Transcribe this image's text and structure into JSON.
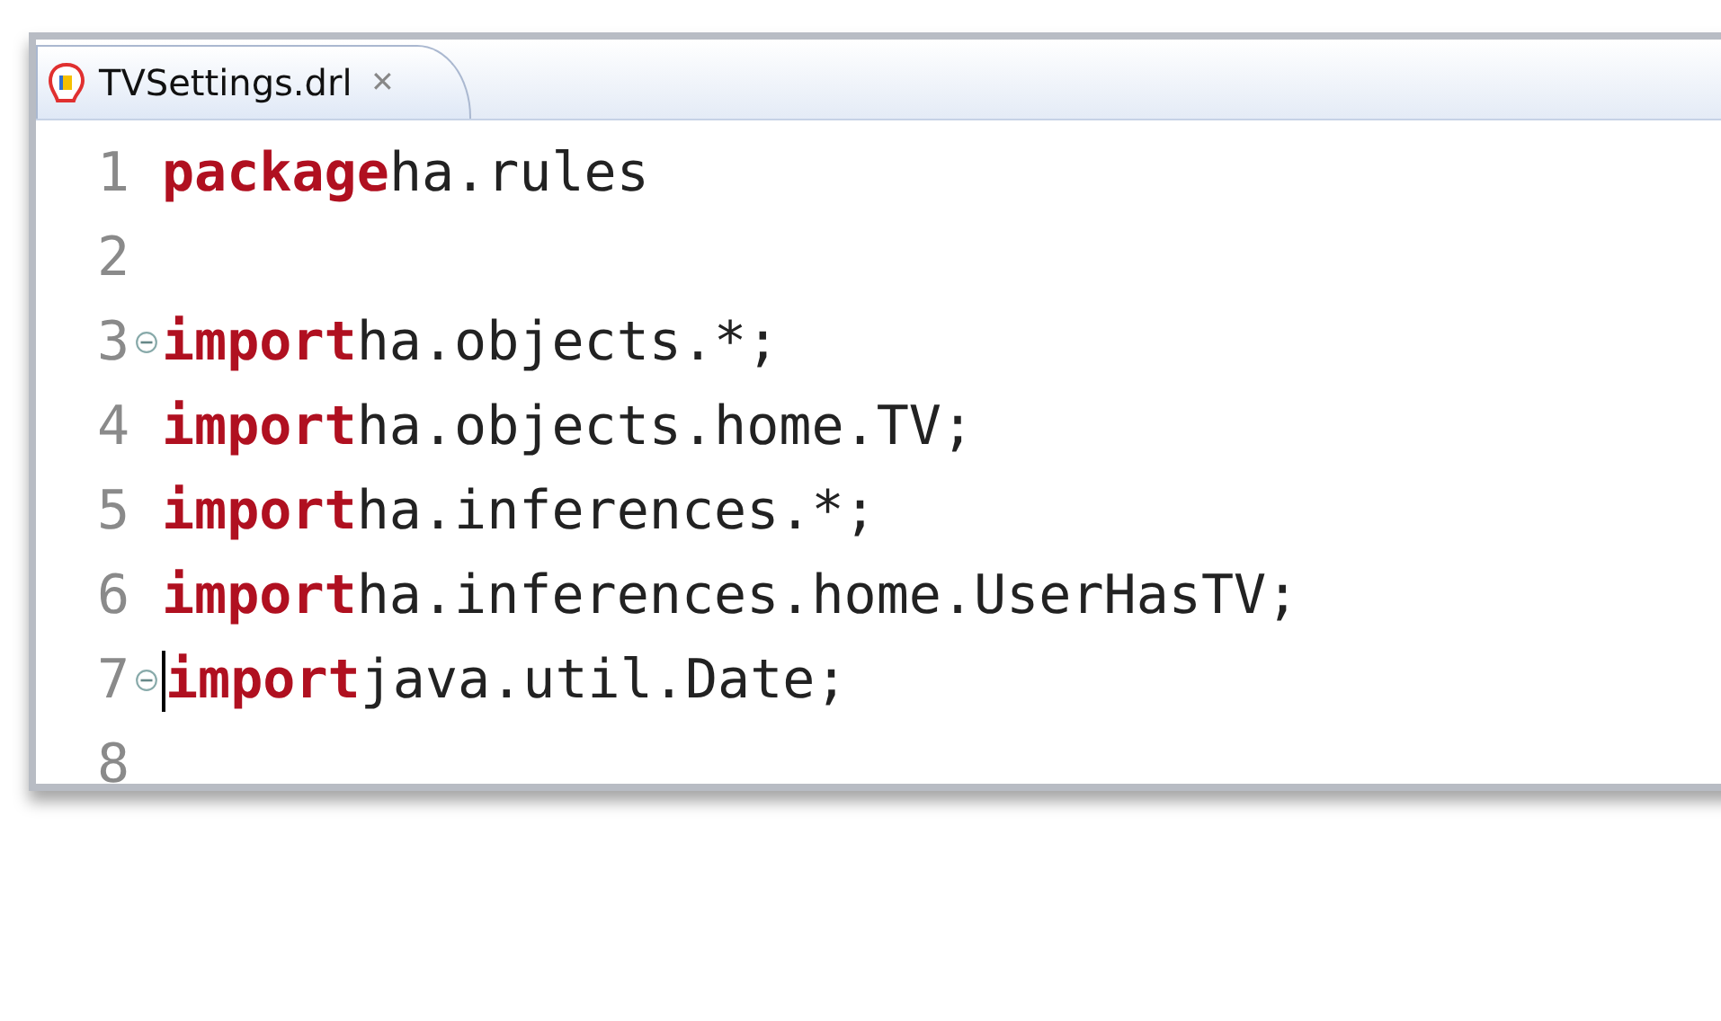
{
  "tab": {
    "title": "TVSettings.drl",
    "close": "✕",
    "selected": true
  },
  "lines": [
    {
      "number": "1",
      "keyword": "package",
      "code": "ha.rules",
      "foldable": false,
      "cursor": false
    },
    {
      "number": "2",
      "foldable": false,
      "cursor": false
    },
    {
      "number": "3",
      "keyword": "import",
      "code": "ha.objects.*;",
      "foldable": true,
      "cursor": false
    },
    {
      "number": "4",
      "keyword": "import",
      "code": "ha.objects.home.TV;",
      "foldable": false,
      "cursor": false
    },
    {
      "number": "5",
      "keyword": "import",
      "code": "ha.inferences.*;",
      "foldable": false,
      "cursor": false
    },
    {
      "number": "6",
      "keyword": "import",
      "code": "ha.inferences.home.UserHasTV;",
      "foldable": false,
      "cursor": false
    },
    {
      "number": "7",
      "keyword": "import",
      "code": "java.util.Date;",
      "foldable": true,
      "cursor": true
    },
    {
      "number": "8",
      "foldable": false,
      "cursor": false
    }
  ]
}
